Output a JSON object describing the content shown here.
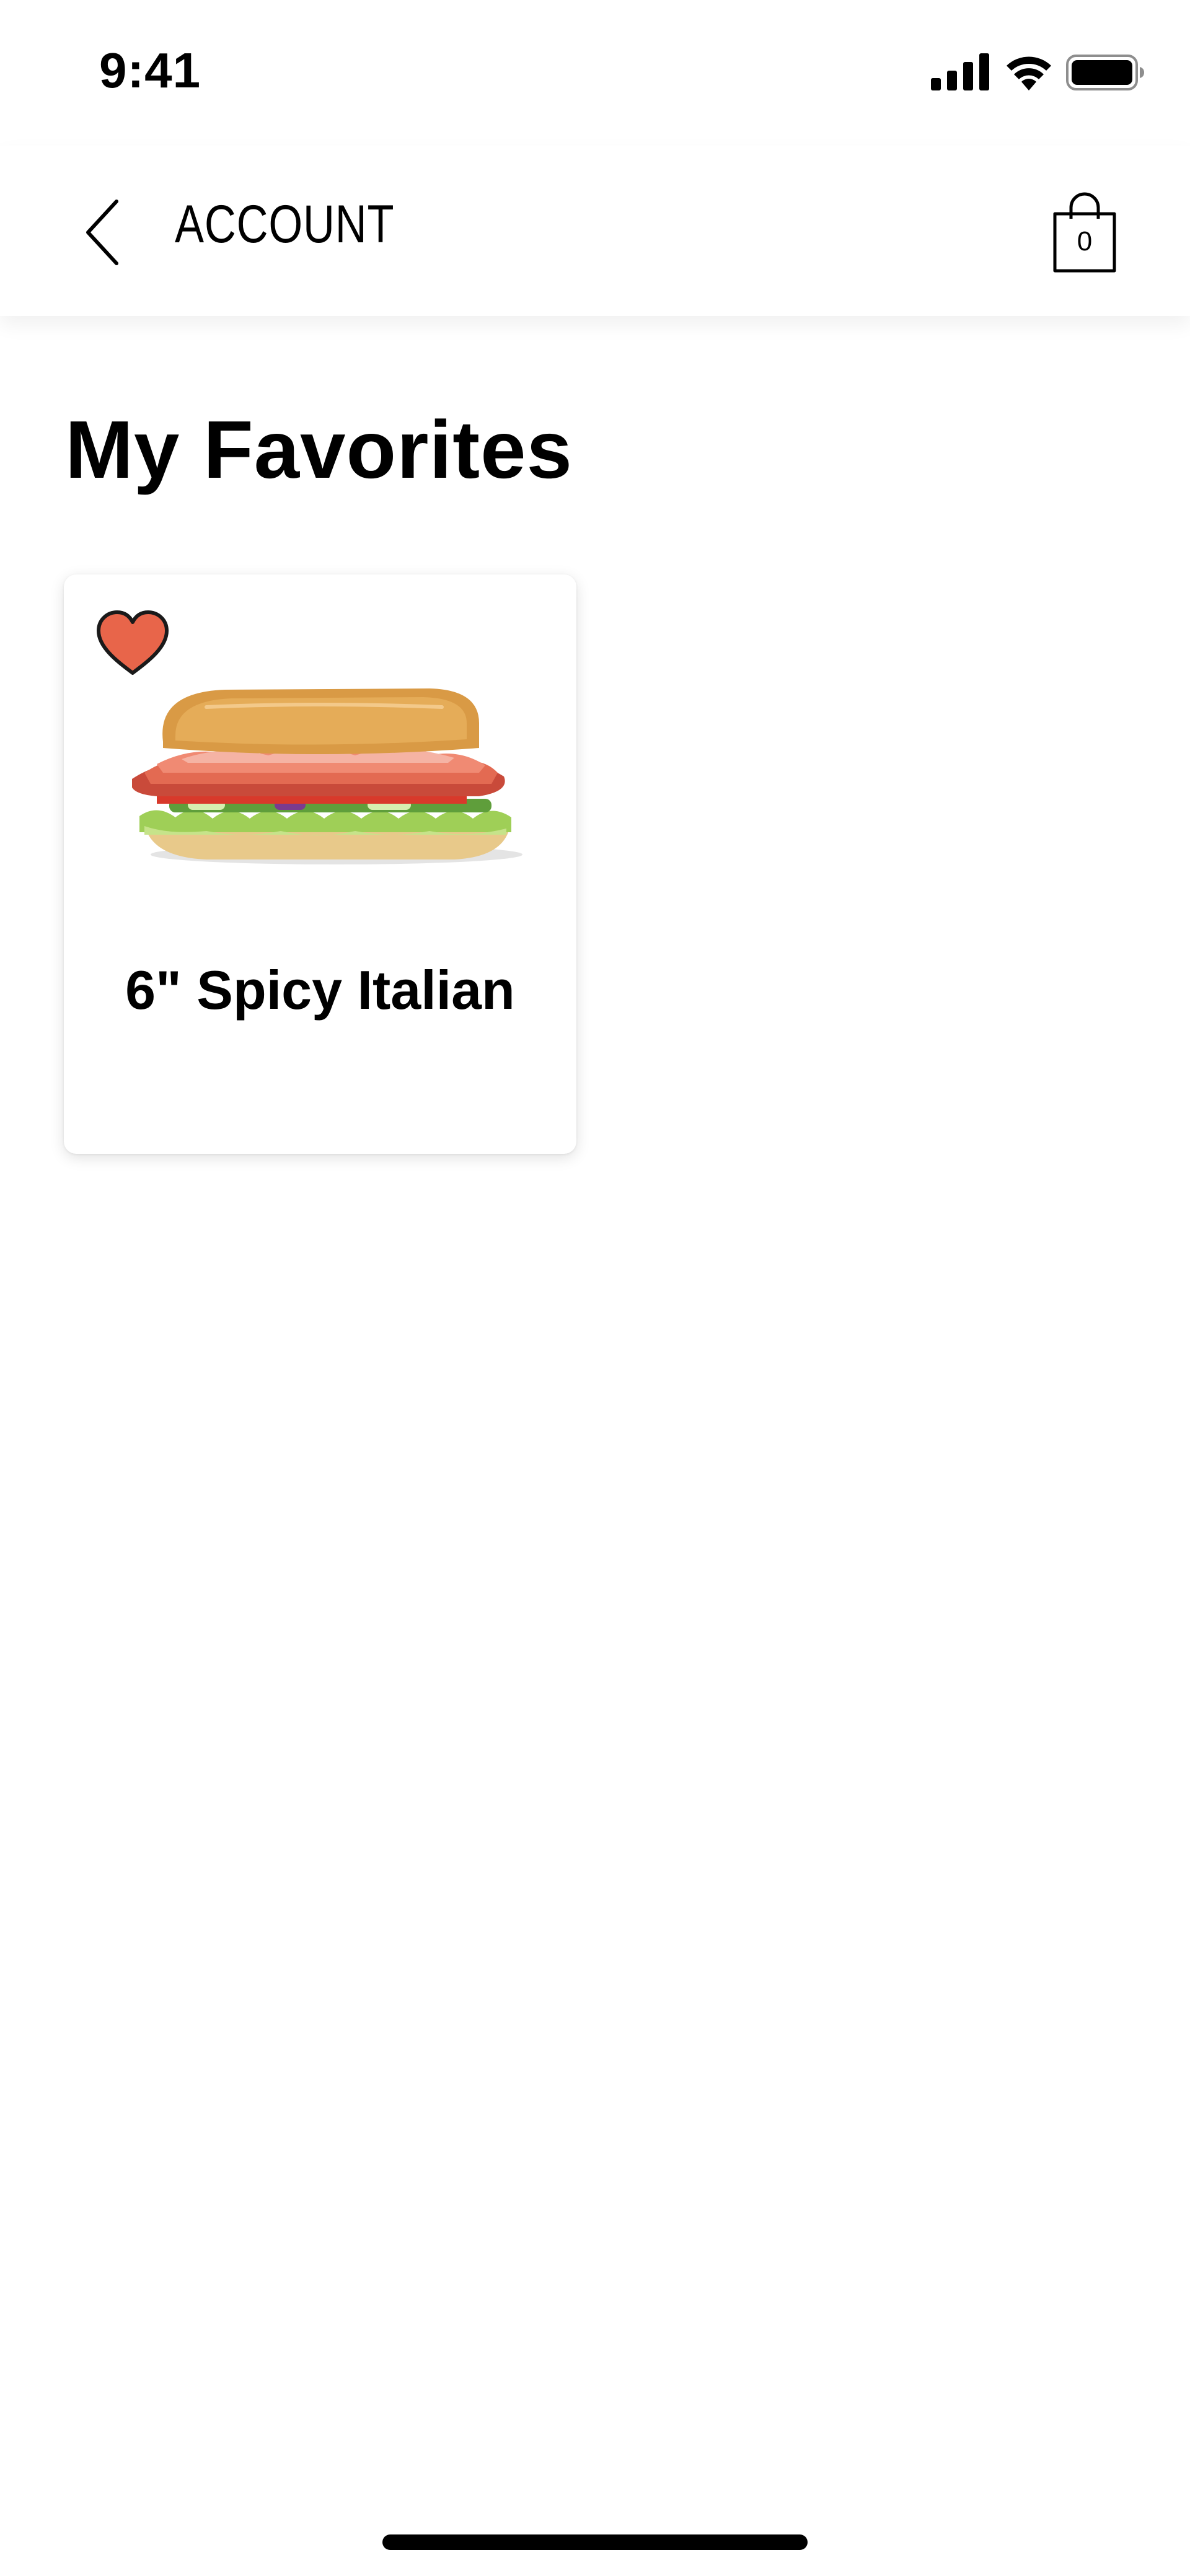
{
  "status_bar": {
    "time": "9:41"
  },
  "header": {
    "title": "ACCOUNT",
    "cart_count": "0"
  },
  "page": {
    "title": "My Favorites"
  },
  "favorites": [
    {
      "name": "6\" Spicy Italian",
      "favorited": true
    }
  ],
  "colors": {
    "heart": "#E8654A",
    "text": "#000000",
    "background": "#FFFFFF"
  },
  "icons": {
    "back": "chevron-left-icon",
    "cart": "shopping-bag-icon",
    "favorite": "heart-icon"
  }
}
